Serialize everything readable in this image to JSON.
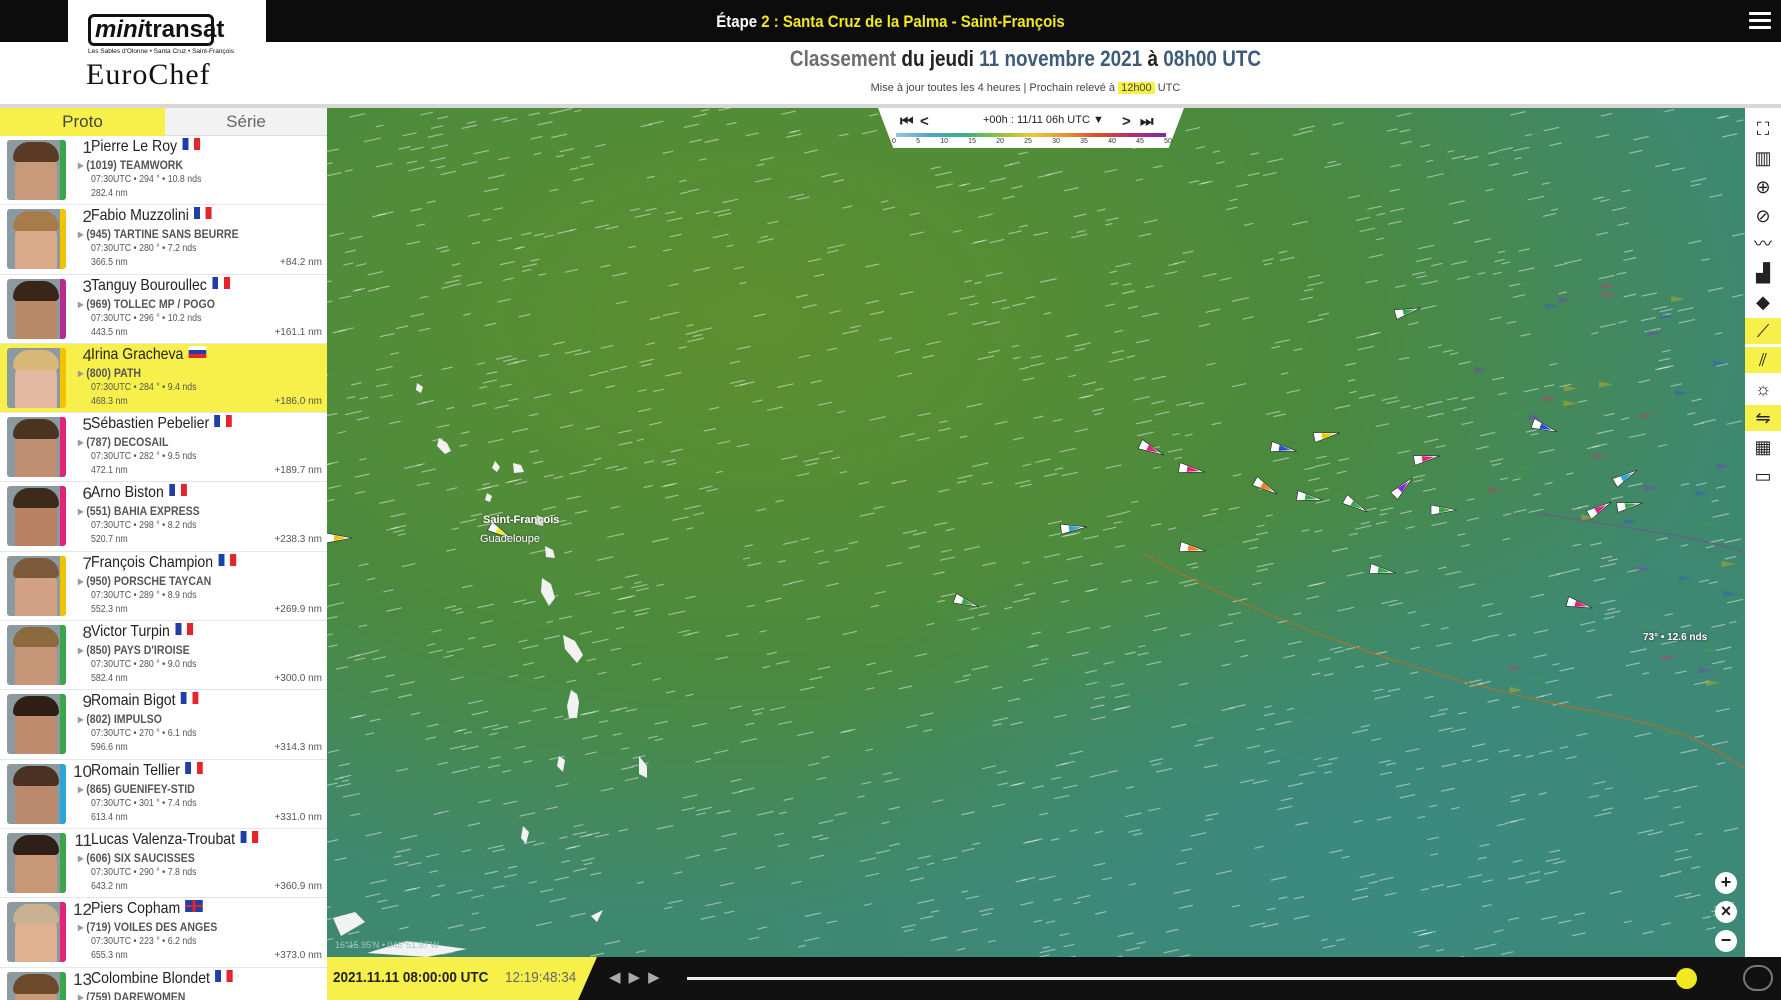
{
  "header": {
    "stage_prefix": "Étape",
    "stage_number": "2",
    "stage_sep": ":",
    "stage_route": "Santa Cruz de la Palma - Saint-François",
    "classement_word": "Classement",
    "classement_day": "du jeudi",
    "classement_date": "11 novembre 2021",
    "classement_at": "à",
    "classement_time": "08h00 UTC",
    "update_note": "Mise à jour toutes les 4 heures | Prochain relevé à",
    "next_time": "12h00",
    "next_tz": "UTC"
  },
  "logo": {
    "mini_text": "mini",
    "transat_text": "transat",
    "sub_text": "Les Sables d'Olonne • Santa Cruz • Saint-François",
    "euro_text": "EuroChef"
  },
  "tabs": [
    {
      "label": "Proto",
      "active": true
    },
    {
      "label": "Série",
      "active": false
    }
  ],
  "ranking": [
    {
      "rank": "1",
      "name": "Pierre Le Roy",
      "flag": "fr",
      "boat": "(1019) TEAMWORK",
      "stats": "07:30UTC • 294 ° • 10.8 nds",
      "dist": "282.4 nm",
      "gap": "",
      "color": "#3aa64a",
      "hl": false
    },
    {
      "rank": "2",
      "name": "Fabio Muzzolini",
      "flag": "fr",
      "boat": "(945) TARTINE SANS BEURRE",
      "stats": "07:30UTC • 280 ° • 7.2 nds",
      "dist": "366.5 nm",
      "gap": "+84.2 nm",
      "color": "#f1c300",
      "hl": false
    },
    {
      "rank": "3",
      "name": "Tanguy Bouroullec",
      "flag": "fr",
      "boat": "(969) TOLLEC MP / POGO",
      "stats": "07:30UTC • 296 ° • 10.2 nds",
      "dist": "443.5 nm",
      "gap": "+161.1 nm",
      "color": "#b22e8e",
      "hl": false
    },
    {
      "rank": "4",
      "name": "Irina Gracheva",
      "flag": "ru",
      "boat": "(800) PATH",
      "stats": "07:30UTC • 284 ° • 9.4 nds",
      "dist": "468.3 nm",
      "gap": "+186.0 nm",
      "color": "#f1c300",
      "hl": true
    },
    {
      "rank": "5",
      "name": "Sébastien Pebelier",
      "flag": "fr",
      "boat": "(787) DECOSAIL",
      "stats": "07:30UTC • 282 ° • 9.5 nds",
      "dist": "472.1 nm",
      "gap": "+189.7 nm",
      "color": "#e0247a",
      "hl": false
    },
    {
      "rank": "6",
      "name": "Arno Biston",
      "flag": "fr",
      "boat": "(551) BAHIA EXPRESS",
      "stats": "07:30UTC • 298 ° • 8.2 nds",
      "dist": "520.7 nm",
      "gap": "+238.3 nm",
      "color": "#e0247a",
      "hl": false
    },
    {
      "rank": "7",
      "name": "François Champion",
      "flag": "fr",
      "boat": "(950) PORSCHE TAYCAN",
      "stats": "07:30UTC • 289 ° • 8.9 nds",
      "dist": "552.3 nm",
      "gap": "+269.9 nm",
      "color": "#f1c300",
      "hl": false
    },
    {
      "rank": "8",
      "name": "Victor Turpin",
      "flag": "fr",
      "boat": "(850) PAYS D'IROISE",
      "stats": "07:30UTC • 280 ° • 9.0 nds",
      "dist": "582.4 nm",
      "gap": "+300.0 nm",
      "color": "#3aa64a",
      "hl": false
    },
    {
      "rank": "9",
      "name": "Romain Bigot",
      "flag": "fr",
      "boat": "(802) IMPULSO",
      "stats": "07:30UTC • 270 ° • 6.1 nds",
      "dist": "596.6 nm",
      "gap": "+314.3 nm",
      "color": "#3aa64a",
      "hl": false
    },
    {
      "rank": "10",
      "name": "Romain Tellier",
      "flag": "fr",
      "boat": "(865) GUENIFEY-STID",
      "stats": "07:30UTC • 301 ° • 7.4 nds",
      "dist": "613.4 nm",
      "gap": "+331.0 nm",
      "color": "#2fa4d6",
      "hl": false
    },
    {
      "rank": "11",
      "name": "Lucas Valenza-Troubat",
      "flag": "fr",
      "boat": "(606) SIX SAUCISSES",
      "stats": "07:30UTC • 290 ° • 7.8 nds",
      "dist": "643.2 nm",
      "gap": "+360.9 nm",
      "color": "#3aa64a",
      "hl": false
    },
    {
      "rank": "12",
      "name": "Piers Copham",
      "flag": "gb",
      "boat": "(719) VOILES DES ANGES",
      "stats": "07:30UTC • 223 ° • 6.2 nds",
      "dist": "655.3 nm",
      "gap": "+373.0 nm",
      "color": "#e0247a",
      "hl": false
    },
    {
      "rank": "13",
      "name": "Colombine Blondet",
      "flag": "fr",
      "boat": "(759) DAREWOMEN",
      "stats": "",
      "dist": "",
      "gap": "",
      "color": "#3aa64a",
      "hl": false
    }
  ],
  "timectl": {
    "first": "K",
    "prev": "<",
    "label": "+00h : 11/11 06h UTC",
    "next": ">",
    "last": "K",
    "scale": [
      "0",
      "5",
      "10",
      "15",
      "20",
      "25",
      "30",
      "35",
      "40",
      "45",
      "50"
    ]
  },
  "map": {
    "place_name": "Saint-François",
    "place_region": "Guadeloupe",
    "wind_readout": "73° • 12.6 nds",
    "coords": "16°15.95'N • 046°51.97'W"
  },
  "bottom": {
    "date": "2021.11.11 08:00:00 UTC",
    "clock": "12:19:48:34",
    "play_prev": "◀",
    "play": "▶",
    "play_next": "▶"
  },
  "zoom": {
    "plus": "+",
    "reset": "×",
    "minus": "−"
  },
  "tools": [
    "fullscreen-icon",
    "map-book-icon",
    "target-icon",
    "zoom-search-icon",
    "wind-icon",
    "ranking-chart-icon",
    "tag-icon",
    "track-line-icon",
    "wind-barbs-icon",
    "sun-icon",
    "layers-icon",
    "grid-icon",
    "ruler-icon"
  ],
  "colors": {
    "accent_yellow": "#f7f04a",
    "sea_green": "#4c8a3e",
    "dark_bar": "#0c0c0c"
  }
}
